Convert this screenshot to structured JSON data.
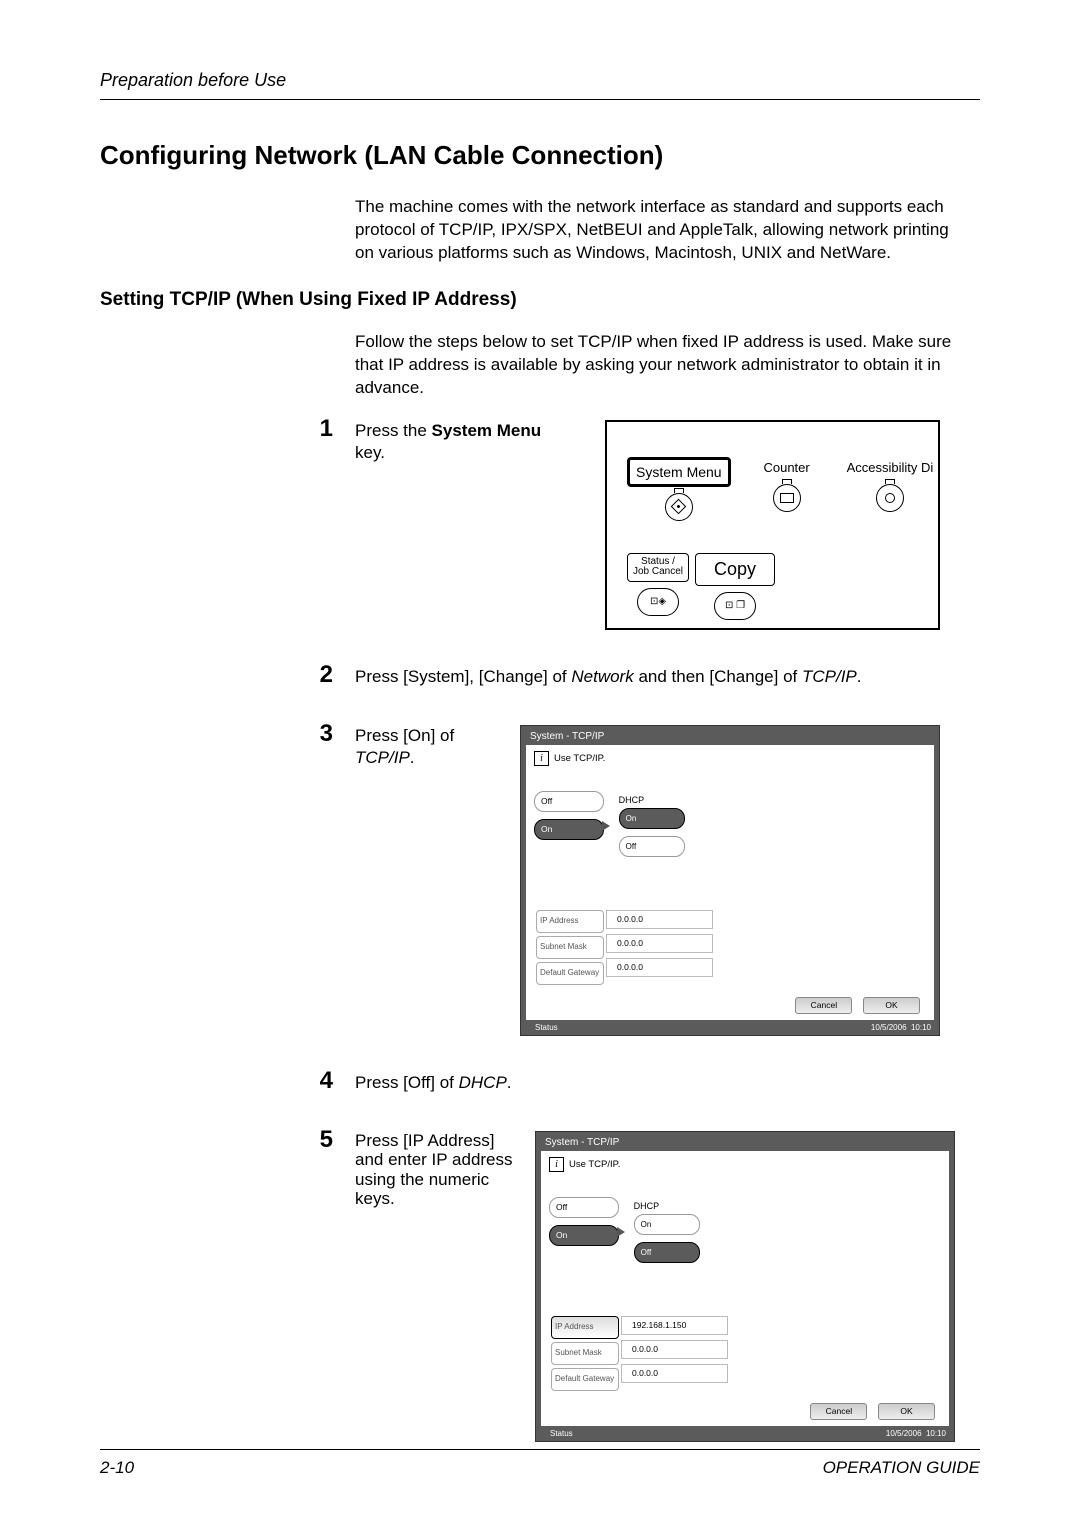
{
  "header": {
    "chapter": "Preparation before Use"
  },
  "section_title": "Configuring Network (LAN Cable Connection)",
  "intro": "The machine comes with the network interface as standard and supports each protocol of TCP/IP, IPX/SPX, NetBEUI and AppleTalk, allowing network printing on various platforms such as Windows, Macintosh, UNIX and NetWare.",
  "subheading": "Setting TCP/IP (When Using Fixed IP Address)",
  "follow": "Follow the steps below to set TCP/IP when fixed IP address is used. Make sure that IP address is available by asking your network administrator to obtain it in advance.",
  "steps": {
    "s1": {
      "num": "1",
      "before": "Press the ",
      "bold": "System Menu",
      "after": " key."
    },
    "s2": {
      "num": "2",
      "text_before": "Press [System], [Change] of ",
      "italic1": "Network",
      "mid": " and then [Change] of ",
      "italic2": "TCP/IP",
      "after": "."
    },
    "s3": {
      "num": "3",
      "before": "Press [On] of ",
      "italic": "TCP/IP",
      "after": "."
    },
    "s4": {
      "num": "4",
      "before": "Press [Off] of ",
      "italic": "DHCP",
      "after": "."
    },
    "s5": {
      "num": "5",
      "text": "Press [IP Address] and enter IP address using the numeric keys."
    }
  },
  "panel": {
    "system_menu": "System Menu",
    "counter": "Counter",
    "accessibility": "Accessibility Di",
    "status": "Status /",
    "jobcancel": "Job Cancel",
    "copy": "Copy"
  },
  "screen3": {
    "title": "System - TCP/IP",
    "use": "Use TCP/IP.",
    "off": "Off",
    "on": "On",
    "dhcp": "DHCP",
    "dhcp_on": "On",
    "dhcp_off": "Off",
    "ip_label": "IP Address",
    "ip_val": "0.0.0.0",
    "mask_label": "Subnet Mask",
    "mask_val": "0.0.0.0",
    "gw_label": "Default Gateway",
    "gw_val": "0.0.0.0",
    "cancel": "Cancel",
    "ok": "OK",
    "status": "Status",
    "date": "10/5/2006",
    "time": "10:10"
  },
  "screen5": {
    "title": "System - TCP/IP",
    "use": "Use TCP/IP.",
    "off": "Off",
    "on": "On",
    "dhcp": "DHCP",
    "dhcp_on": "On",
    "dhcp_off": "Off",
    "ip_label": "IP Address",
    "ip_val": "192.168.1.150",
    "mask_label": "Subnet Mask",
    "mask_val": "0.0.0.0",
    "gw_label": "Default Gateway",
    "gw_val": "0.0.0.0",
    "cancel": "Cancel",
    "ok": "OK",
    "status": "Status",
    "date": "10/5/2006",
    "time": "10:10"
  },
  "footer": {
    "page": "2-10",
    "guide": "OPERATION GUIDE"
  }
}
